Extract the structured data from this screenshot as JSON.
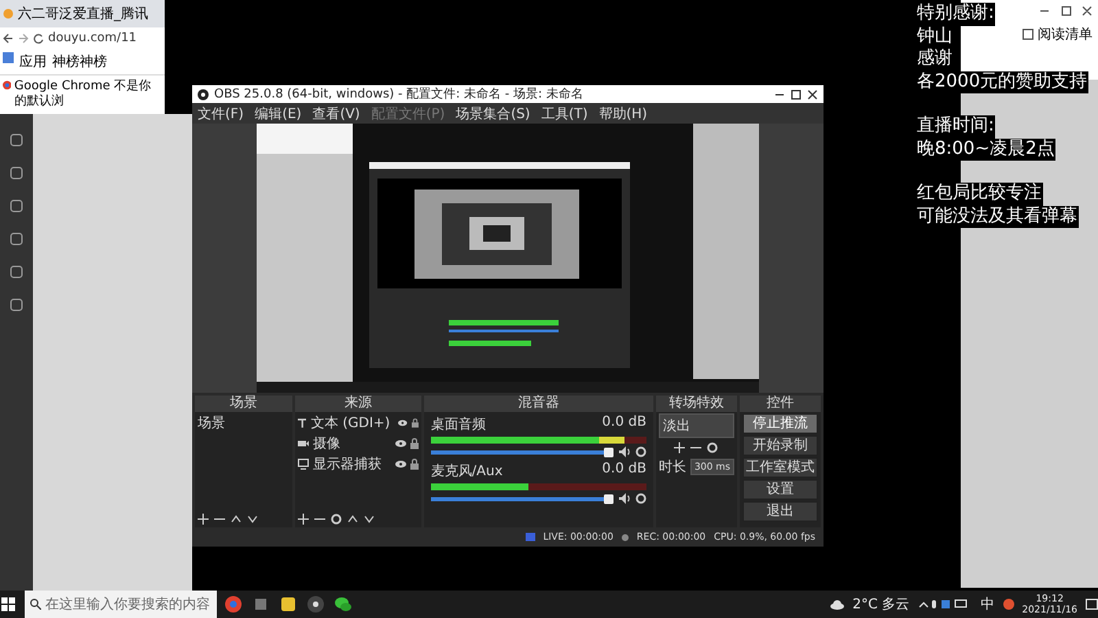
{
  "left_browser": {
    "tab_title": "六二哥泛爱直播_腾讯",
    "address": "douyu.com/11",
    "bookmarks": [
      "应用",
      "神榜神榜"
    ],
    "infobar": "Google Chrome 不是你的默认浏"
  },
  "obs": {
    "title": "OBS 25.0.8 (64-bit, windows) - 配置文件: 未命名 - 场景: 未命名",
    "menu": [
      {
        "label": "文件(F)",
        "disabled": false
      },
      {
        "label": "编辑(E)",
        "disabled": false
      },
      {
        "label": "查看(V)",
        "disabled": false
      },
      {
        "label": "配置文件(P)",
        "disabled": true
      },
      {
        "label": "场景集合(S)",
        "disabled": false
      },
      {
        "label": "工具(T)",
        "disabled": false
      },
      {
        "label": "帮助(H)",
        "disabled": false
      }
    ],
    "dock_titles": [
      "场景",
      "来源",
      "混音器",
      "转场特效",
      "控件"
    ],
    "scenes": [
      "场景"
    ],
    "sources": [
      {
        "kind": "text",
        "label": "文本 (GDI+)"
      },
      {
        "kind": "camera",
        "label": "摄像"
      },
      {
        "kind": "display",
        "label": "显示器捕获"
      }
    ],
    "mixer": [
      {
        "name": "桌面音频",
        "reading": "0.0 dB",
        "level": 0.9,
        "fader": {
          "level": 1
        }
      },
      {
        "name": "麦克风/Aux",
        "reading": "0.0 dB",
        "level": 0.45,
        "fader": {
          "level": 1
        }
      }
    ],
    "transition": {
      "type": "淡出",
      "duration_label": "时长",
      "duration": "300 ms"
    },
    "controls": [
      {
        "label": "停止推流",
        "active": true
      },
      {
        "label": "开始录制",
        "active": false
      },
      {
        "label": "工作室模式",
        "active": false
      },
      {
        "label": "设置",
        "active": false
      },
      {
        "label": "退出",
        "active": false
      }
    ],
    "status": {
      "live": "LIVE: 00:00:00",
      "rec": "REC: 00:00:00",
      "cpu": "CPU: 0.9%, 60.00 fps"
    }
  },
  "right_browser": {
    "reading_list": "阅读清单"
  },
  "overlay_text": [
    [
      "特别感谢:",
      "钟山",
      "感谢",
      "各2000元的赞助支持"
    ],
    [
      "直播时间:",
      "晚8:00~凌晨2点"
    ],
    [
      "红包局比较专注",
      "可能没法及其看弹幕"
    ]
  ],
  "taskbar": {
    "search_placeholder": "在这里输入你要搜索的内容",
    "weather": "2°C 多云",
    "ime": "中",
    "time": "19:12",
    "date": "2021/11/16"
  }
}
